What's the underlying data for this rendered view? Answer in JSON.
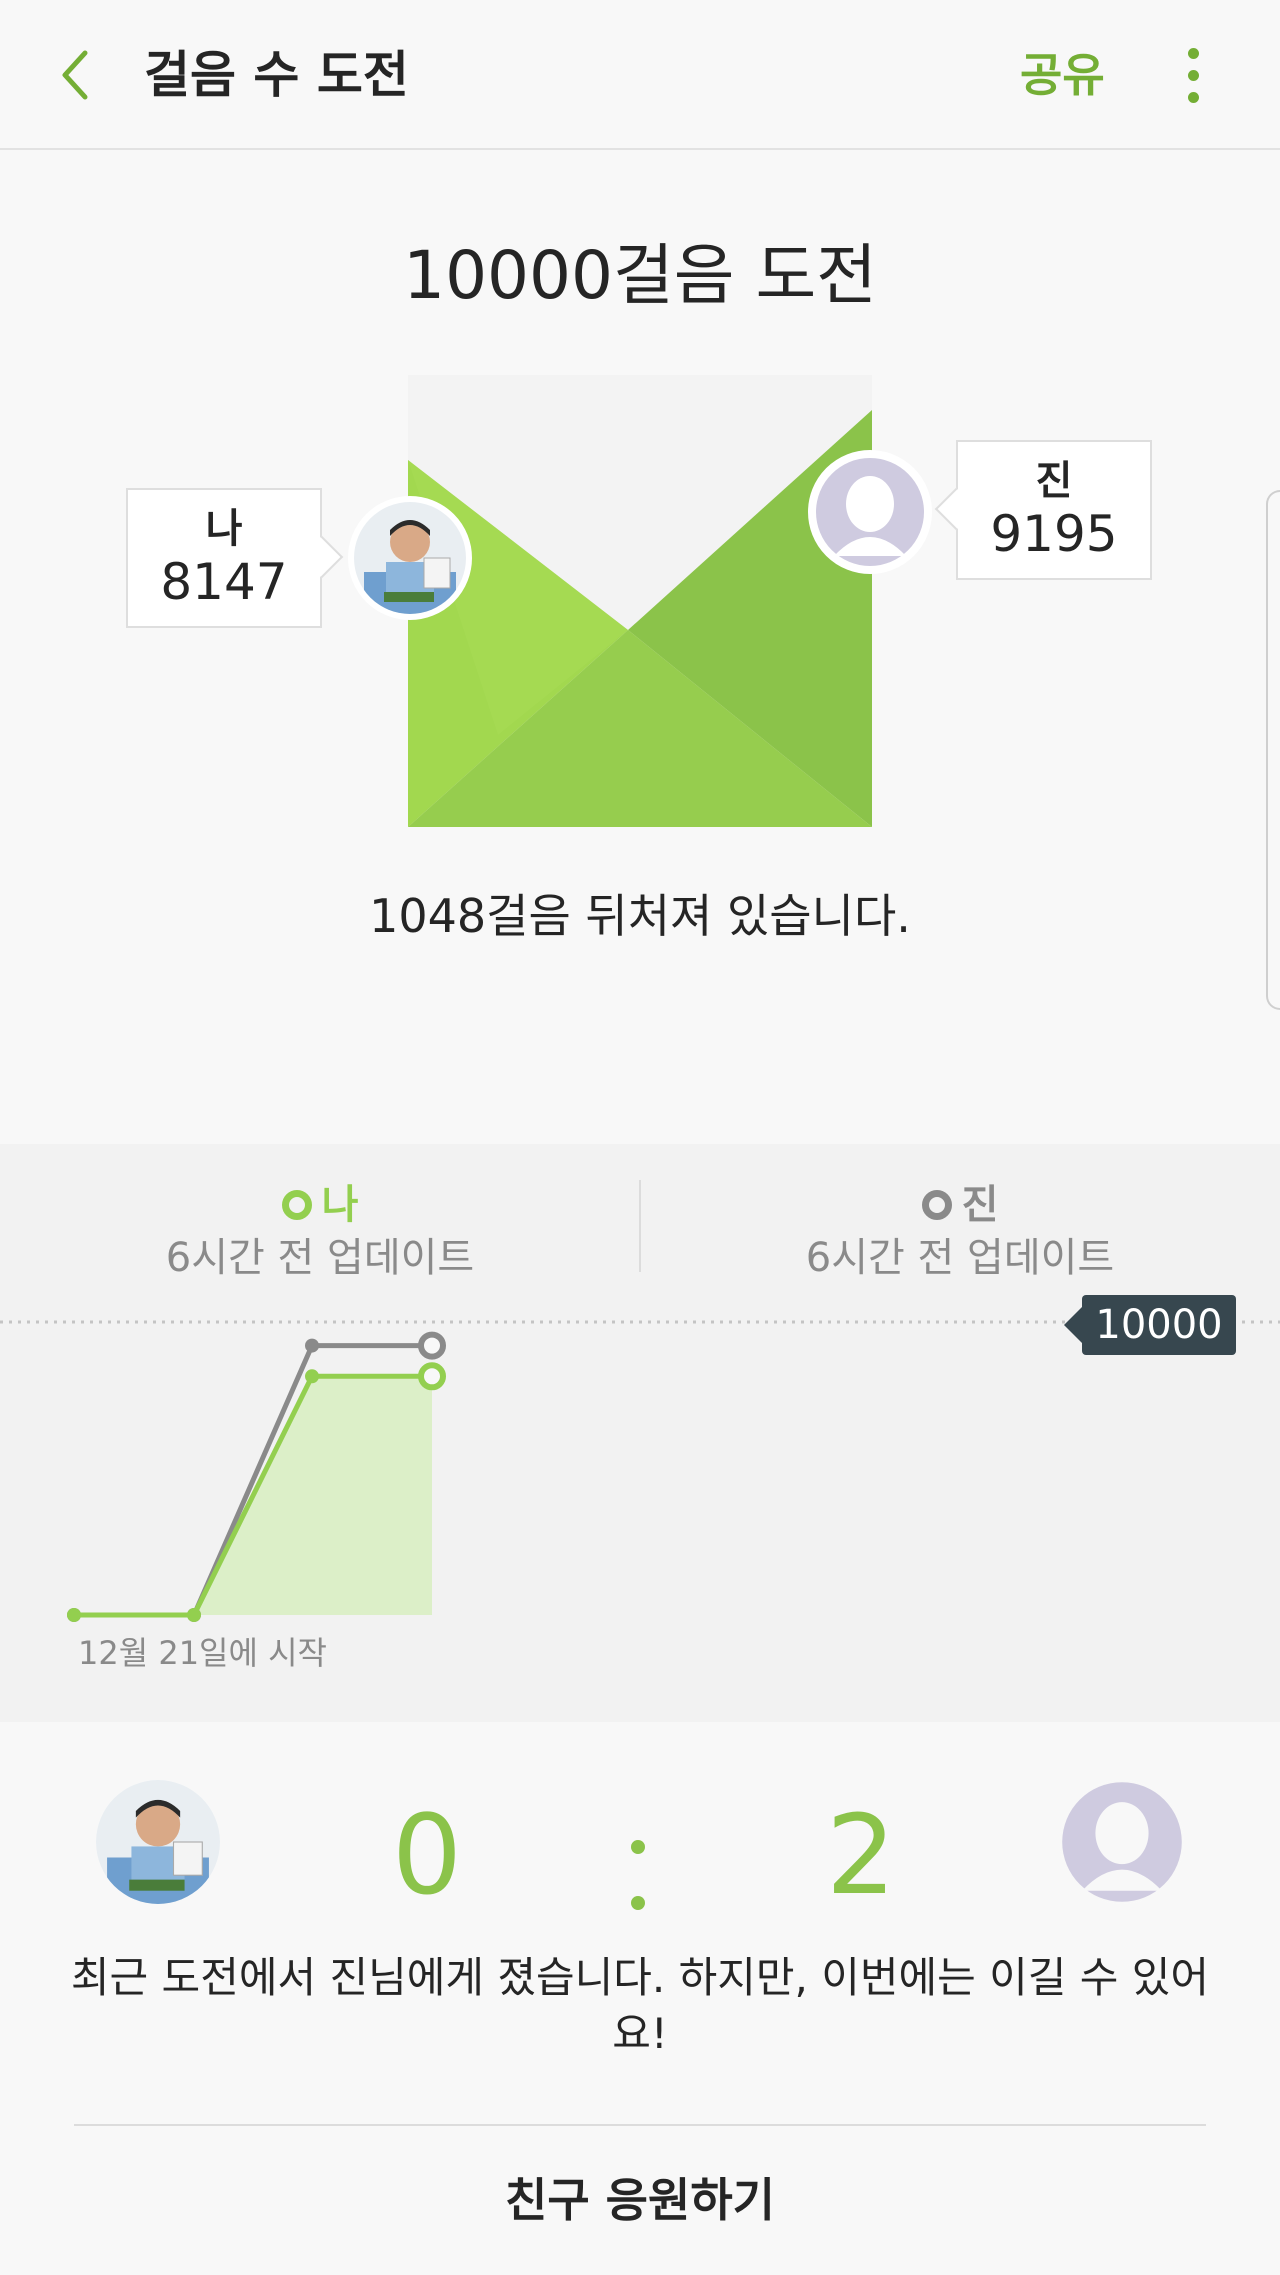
{
  "appbar": {
    "title": "걸음 수 도전",
    "share_label": "공유",
    "back_icon": "chevron-left-icon",
    "more_icon": "more-vertical-icon",
    "accent_color": "#74ae35"
  },
  "challenge": {
    "title": "10000걸음 도전",
    "me": {
      "name": "나",
      "steps": "8147"
    },
    "friend": {
      "name": "진",
      "steps": "9195"
    },
    "status_text": "1048걸음 뒤처져 있습니다."
  },
  "progress_chart": {
    "legend_me": {
      "name": "나",
      "updated": "6시간 전 업데이트",
      "color": "#93cf4f"
    },
    "legend_friend": {
      "name": "진",
      "updated": "6시간 전 업데이트",
      "color": "#8a8a8a"
    },
    "goal_label": "10000",
    "start_label": "12월 21일에 시작"
  },
  "chart_data": {
    "type": "line",
    "ylim": [
      0,
      10000
    ],
    "goal": 10000,
    "series": [
      {
        "name": "나",
        "points": [
          [
            0,
            0
          ],
          [
            1,
            0
          ],
          [
            2,
            8147
          ],
          [
            3,
            8147
          ]
        ],
        "color": "#93cf4f"
      },
      {
        "name": "진",
        "points": [
          [
            0,
            0
          ],
          [
            1,
            0
          ],
          [
            2,
            9195
          ],
          [
            3,
            9195
          ]
        ],
        "color": "#8a8a8a"
      }
    ]
  },
  "record": {
    "me_wins": "0",
    "friend_wins": "2",
    "message": "최근 도전에서 진님에게 졌습니다. 하지만, 이번에는 이길 수 있어요!"
  },
  "cheer_button": {
    "label": "친구 응원하기"
  }
}
